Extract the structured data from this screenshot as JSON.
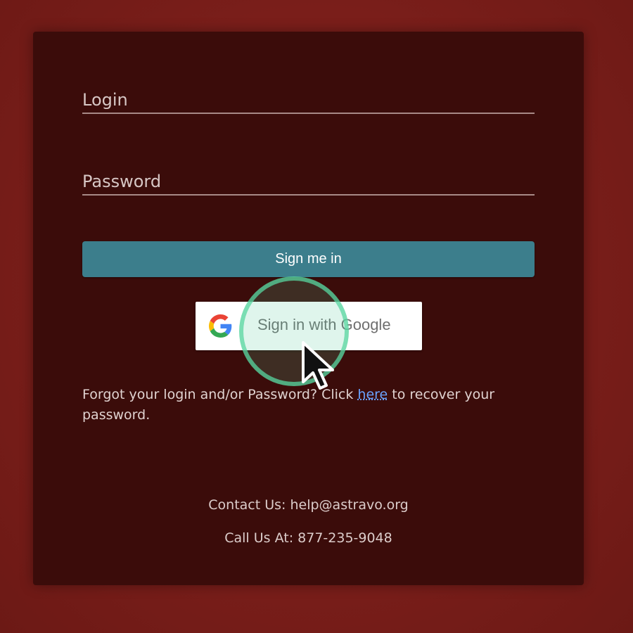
{
  "login_form": {
    "login_placeholder": "Login",
    "password_placeholder": "Password",
    "sign_in_label": "Sign me in",
    "google_label": "Sign in with Google"
  },
  "recovery": {
    "text_before": "Forgot your login and/or Password? Click ",
    "link_text": "here",
    "text_after": " to recover your password."
  },
  "contact": {
    "email_line": "Contact Us: help@astravo.org",
    "phone_line": "Call Us At: 877-235-9048"
  },
  "colors": {
    "background": "#7a1e1a",
    "card": "#3b0c0a",
    "primary_button": "#3c7e8c",
    "link": "#6aa3ff",
    "click_indicator": "#58d6a0"
  },
  "icons": {
    "google": "google-g-icon",
    "pointer": "mouse-pointer-icon"
  }
}
